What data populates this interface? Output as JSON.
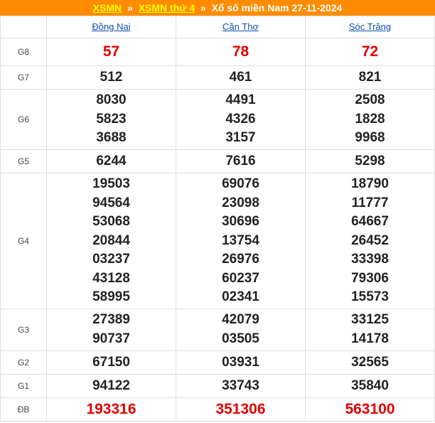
{
  "header": {
    "link1": "XSMN",
    "sep": "»",
    "link2": "XSMN thứ 4",
    "title": "Xổ số miền Nam 27-11-2024"
  },
  "provinces": [
    "Đồng Nai",
    "Cần Thơ",
    "Sóc Trăng"
  ],
  "colors": {
    "header_bg": "#ff8c00",
    "link_yellow": "#ffff00",
    "special_red": "#e00000",
    "province_blue": "#0b4fa8"
  },
  "prizes": [
    {
      "label": "G8",
      "values": [
        [
          "57"
        ],
        [
          "78"
        ],
        [
          "72"
        ]
      ]
    },
    {
      "label": "G7",
      "values": [
        [
          "512"
        ],
        [
          "461"
        ],
        [
          "821"
        ]
      ]
    },
    {
      "label": "G6",
      "values": [
        [
          "8030",
          "5823",
          "3688"
        ],
        [
          "4491",
          "4326",
          "3157"
        ],
        [
          "2508",
          "1828",
          "9968"
        ]
      ]
    },
    {
      "label": "G5",
      "values": [
        [
          "6244"
        ],
        [
          "7616"
        ],
        [
          "5298"
        ]
      ]
    },
    {
      "label": "G4",
      "values": [
        [
          "19503",
          "94564",
          "53068",
          "20844",
          "03237",
          "43128",
          "58995"
        ],
        [
          "69076",
          "23098",
          "30696",
          "13754",
          "26976",
          "60237",
          "02341"
        ],
        [
          "18790",
          "11777",
          "64667",
          "26452",
          "33398",
          "79306",
          "15573"
        ]
      ]
    },
    {
      "label": "G3",
      "values": [
        [
          "27389",
          "90737"
        ],
        [
          "42079",
          "03505"
        ],
        [
          "33125",
          "14178"
        ]
      ]
    },
    {
      "label": "G2",
      "values": [
        [
          "67150"
        ],
        [
          "03931"
        ],
        [
          "32565"
        ]
      ]
    },
    {
      "label": "G1",
      "values": [
        [
          "94122"
        ],
        [
          "33743"
        ],
        [
          "35840"
        ]
      ]
    },
    {
      "label": "ĐB",
      "values": [
        [
          "193316"
        ],
        [
          "351306"
        ],
        [
          "563100"
        ]
      ]
    }
  ]
}
